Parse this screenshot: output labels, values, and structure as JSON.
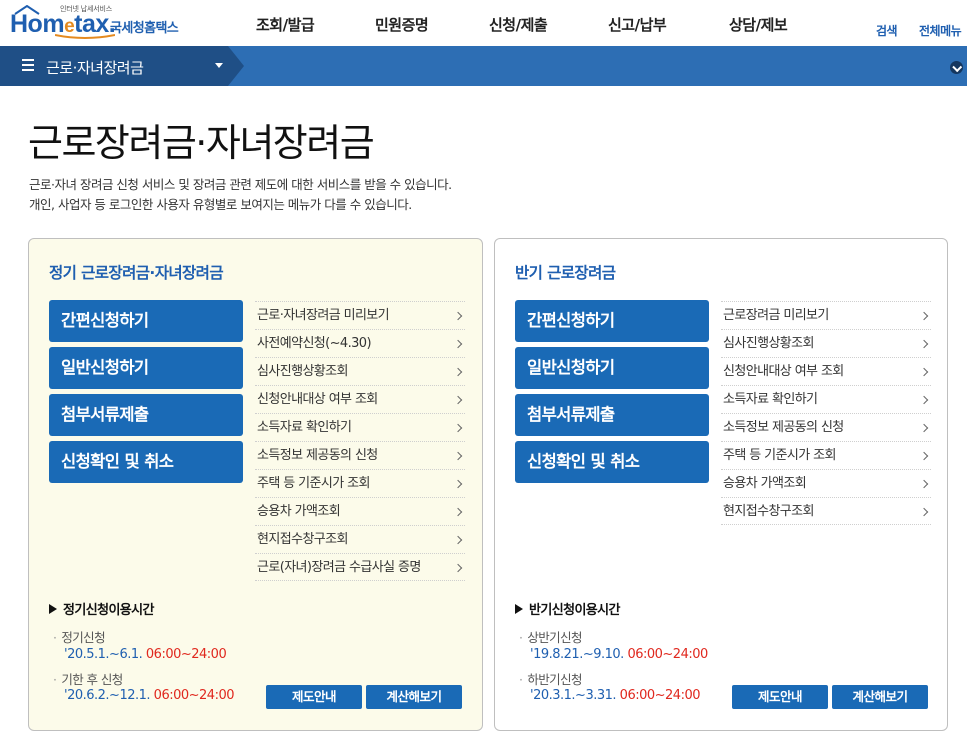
{
  "header": {
    "logo_tagline": "인터넷 납세서비스",
    "logo_name_pre": "Hom",
    "logo_name_e": "e",
    "logo_name_post": "tax.",
    "logo_sub": "국세청홈택스",
    "nav": [
      "조회/발급",
      "민원증명",
      "신청/제출",
      "신고/납부",
      "상담/제보"
    ],
    "search": "검색",
    "all_menu": "전체메뉴"
  },
  "subbar": {
    "menu_label": "근로·자녀장려금"
  },
  "main": {
    "title": "근로장려금·자녀장려금",
    "desc_1": "근로·자녀 장려금 신청 서비스 및 장려금 관련 제도에 대한 서비스를 받을 수 있습니다.",
    "desc_2": "개인, 사업자 등 로그인한 사용자 유형별로 보여지는 메뉴가 다를 수 있습니다."
  },
  "panels": [
    {
      "title": "정기 근로장려금·자녀장려금",
      "buttons": [
        "간편신청하기",
        "일반신청하기",
        "첨부서류제출",
        "신청확인 및 취소"
      ],
      "links": [
        "근로·자녀장려금 미리보기",
        "사전예약신청(~4.30)",
        "심사진행상황조회",
        "신청안내대상 여부 조회",
        "소득자료 확인하기",
        "소득정보 제공동의 신청",
        "주택 등 기준시가 조회",
        "승용차 가액조회",
        "현지접수창구조회",
        "근로(자녀)장려금 수급사실 증명"
      ],
      "hours_title": "정기신청이용시간",
      "hours": [
        {
          "label": "정기신청",
          "date": "'20.5.1.~6.1.",
          "time": "06:00~24:00"
        },
        {
          "label": "기한 후 신청",
          "date": "'20.6.2.~12.1.",
          "time": "06:00~24:00"
        }
      ],
      "btn_guide": "제도안내",
      "btn_calc": "계산해보기"
    },
    {
      "title": "반기 근로장려금",
      "buttons": [
        "간편신청하기",
        "일반신청하기",
        "첨부서류제출",
        "신청확인 및 취소"
      ],
      "links": [
        "근로장려금 미리보기",
        "심사진행상황조회",
        "신청안내대상 여부 조회",
        "소득자료 확인하기",
        "소득정보 제공동의 신청",
        "주택 등 기준시가 조회",
        "승용차 가액조회",
        "현지접수창구조회"
      ],
      "hours_title": "반기신청이용시간",
      "hours": [
        {
          "label": "상반기신청",
          "date": "'19.8.21.~9.10.",
          "time": "06:00~24:00"
        },
        {
          "label": "하반기신청",
          "date": "'20.3.1.~3.31.",
          "time": "06:00~24:00"
        }
      ],
      "btn_guide": "제도안내",
      "btn_calc": "계산해보기"
    }
  ],
  "colors": {
    "brand_blue": "#1f5fb0",
    "button_blue": "#1a6ab6",
    "subbar_blue": "#2d6eb4",
    "subbar_tab": "#1f4f86",
    "panel_yellow": "#fcfbea",
    "time_red": "#e0281e",
    "logo_orange": "#e58a1f"
  }
}
